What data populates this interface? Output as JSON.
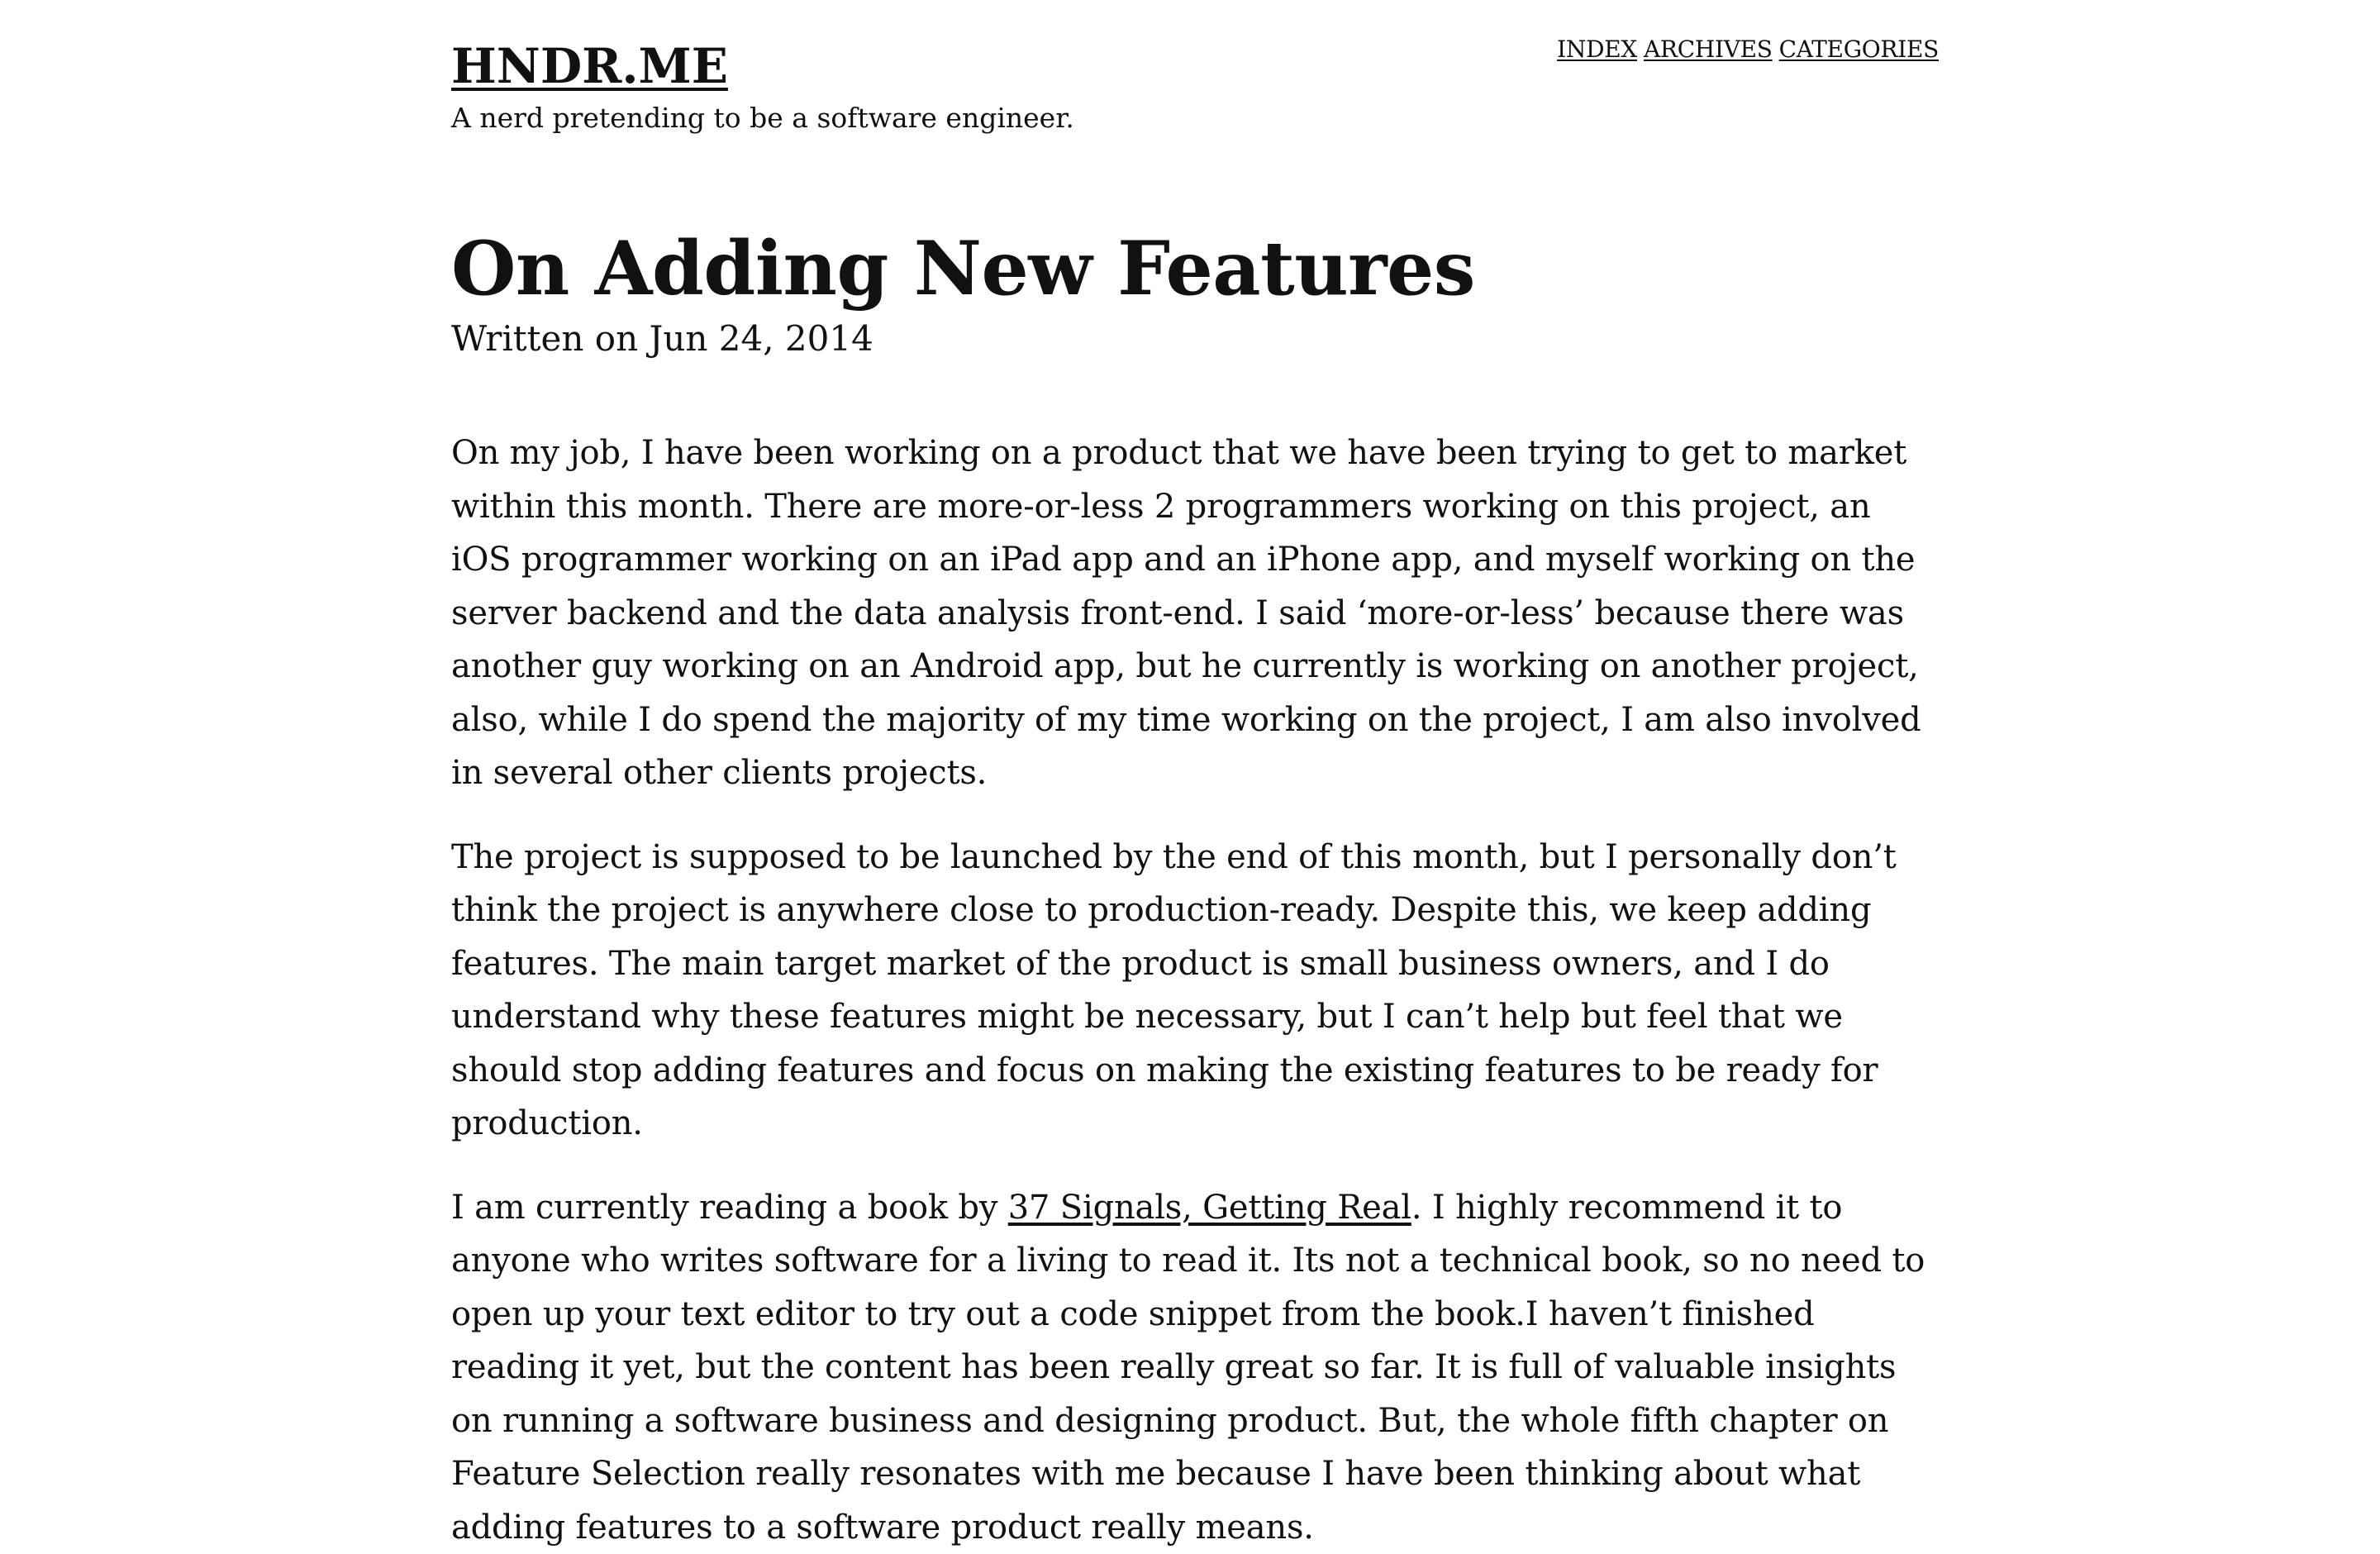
{
  "site": {
    "title": "HNDR.ME",
    "tagline": "A nerd pretending to be a software engineer."
  },
  "nav": {
    "index": "INDEX",
    "archives": "ARCHIVES",
    "categories": "CATEGORIES"
  },
  "post": {
    "title": "On Adding New Features",
    "meta": "Written on Jun 24, 2014",
    "p1": "On my job, I have been working on a product that we have been trying to get to market within this month. There are more-or-less 2 programmers working on this project, an iOS programmer working on an iPad app and an iPhone app, and myself working on the server backend and the data analysis front-end. I said ‘more-or-less’ because there was another guy working on an Android app, but he currently is working on another project, also, while I do spend the majority of my time working on the project, I am also involved in several other clients projects.",
    "p2": "The project is supposed to be launched by the end of this month, but I personally don’t think the project is anywhere close to production-ready. Despite this, we keep adding features. The main target market of the product is small business owners, and I do understand why these features might be necessary, but I can’t help but feel that we should stop adding features and focus on making the existing features to be ready for production.",
    "p3_before": "I am currently reading a book by ",
    "p3_link": "37 Signals, Getting Real",
    "p3_after": ". I highly recommend it to anyone who writes software for a living to read it. Its not a technical book, so no need to open up your text editor to try out a code snippet from the book.I haven’t finished reading it yet, but the content has been really great so far. It is full of valuable insights on running a software business and designing product. But, the whole fifth chapter on Feature Selection really resonates with me because I have been thinking about what adding features to a software product really means."
  }
}
